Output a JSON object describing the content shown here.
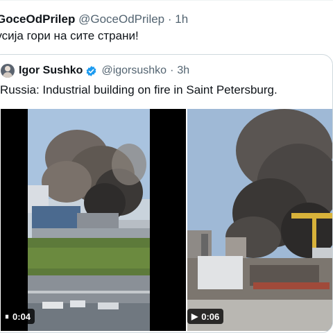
{
  "outer_tweet": {
    "display_name": "GoceOdPrilep",
    "handle": "@GoceOdPrilep",
    "separator": "·",
    "time": "1h",
    "text": "Русија гори на сите страни!"
  },
  "quoted_tweet": {
    "display_name": "Igor Sushko",
    "handle": "@igorsushko",
    "separator": "·",
    "time": "3h",
    "text": "Russia: Industrial building on fire in Saint Petersburg.",
    "media": [
      {
        "kind": "video",
        "state": "playing",
        "control_icon": "pause-icon",
        "control_glyph": "⏸",
        "timestamp": "0:04"
      },
      {
        "kind": "video",
        "state": "paused",
        "control_icon": "play-icon",
        "control_glyph": "▶",
        "timestamp": "0:06"
      }
    ]
  },
  "colors": {
    "text_primary": "#0f1419",
    "text_secondary": "#536471",
    "border": "#cfd9de",
    "verified_blue": "#1d9bf0"
  }
}
